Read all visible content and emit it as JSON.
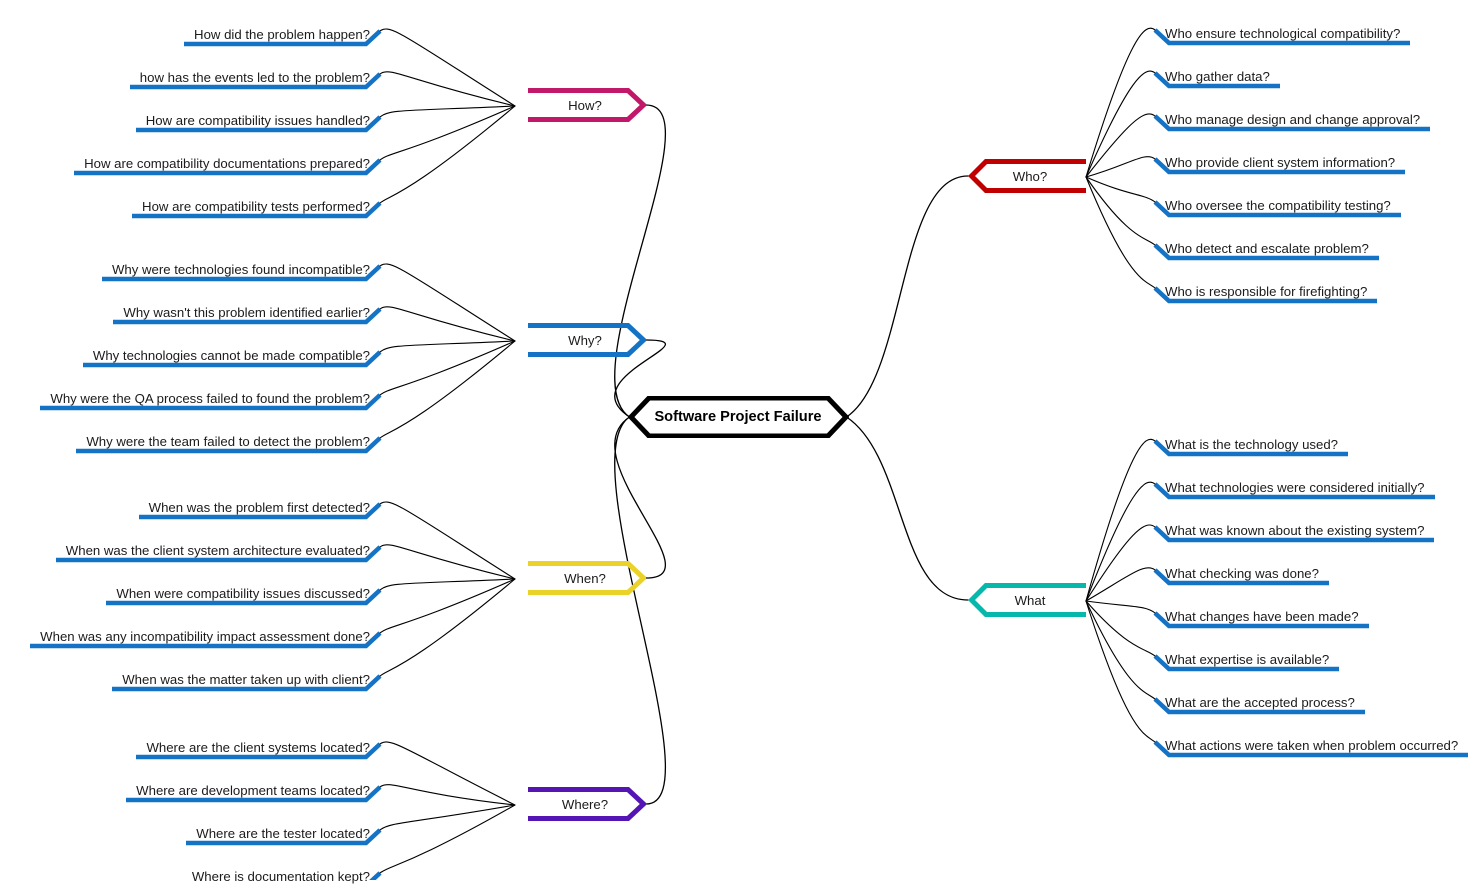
{
  "diagram": {
    "type": "fishbone-mindmap",
    "center": {
      "label": "Software Project Failure",
      "color": "#000000"
    },
    "branches": [
      {
        "id": "how",
        "label": "How?",
        "color": "#C2186A",
        "side": "left",
        "leaves": [
          "How did the problem happen?",
          "how has the events led to the problem?",
          "How are compatibility issues handled?",
          "How are compatibility documentations prepared?",
          "How are compatibility tests performed?"
        ]
      },
      {
        "id": "why",
        "label": "Why?",
        "color": "#1573C6",
        "side": "left",
        "leaves": [
          "Why were technologies found incompatible?",
          "Why wasn't this problem identified earlier?",
          "Why technologies cannot be made compatible?",
          "Why were the QA process failed to found the problem?",
          "Why were the team failed to detect the problem?"
        ]
      },
      {
        "id": "when",
        "label": "When?",
        "color": "#EBD229",
        "side": "left",
        "leaves": [
          "When was the problem first detected?",
          "When was the client system architecture evaluated?",
          "When were compatibility issues discussed?",
          "When was any incompatibility impact assessment done?",
          "When was the matter taken up with client?"
        ]
      },
      {
        "id": "where",
        "label": "Where?",
        "color": "#5514B4",
        "side": "left",
        "leaves": [
          "Where are the client systems located?",
          "Where are development teams located?",
          "Where are the tester located?",
          "Where is documentation kept?"
        ]
      },
      {
        "id": "who",
        "label": "Who?",
        "color": "#C00000",
        "side": "right",
        "leaves": [
          "Who ensure technological compatibility?",
          "Who gather data?",
          "Who manage design and change approval?",
          "Who provide client system information?",
          "Who oversee the compatibility testing?",
          "Who detect and escalate problem?",
          "Who is responsible for firefighting?"
        ]
      },
      {
        "id": "what",
        "label": "What",
        "color": "#06B8AC",
        "side": "right",
        "leaves": [
          "What is the technology used?",
          "What technologies were considered initially?",
          "What was known about the existing system?",
          "What checking was done?",
          "What changes have been made?",
          "What expertise is available?",
          "What are the accepted process?",
          "What actions were taken when problem occurred?"
        ]
      }
    ],
    "colors": {
      "leaf_underline": "#1573C6",
      "connector": "#000000",
      "background": "#FFFFFF"
    }
  }
}
